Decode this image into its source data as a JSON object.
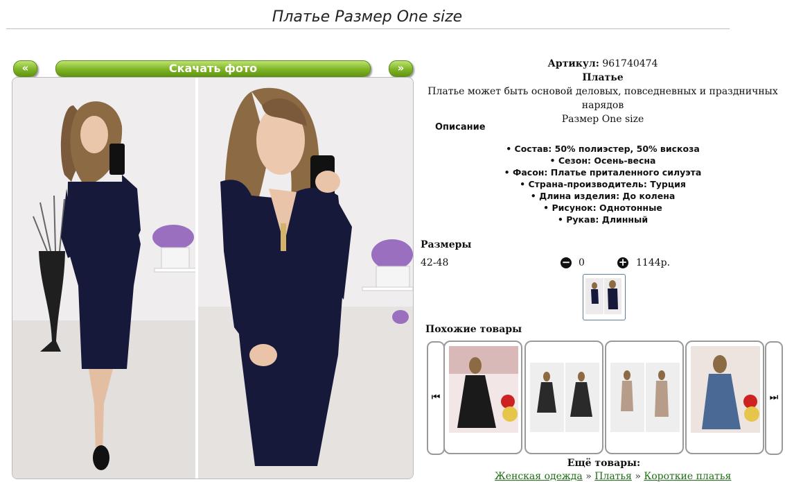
{
  "page": {
    "title": "Платье Размер One size"
  },
  "gallery": {
    "prev_label": "«",
    "download_label": "Скачать фото",
    "next_label": "»"
  },
  "product": {
    "article_label": "Артикул:",
    "article_value": "961740474",
    "name": "Платье",
    "tagline": "Платье может быть основой деловых, повседневных и праздничных нарядов",
    "size_line": "Размер One size"
  },
  "description": {
    "heading": "Описание",
    "features": [
      "Состав: 50% полиэстер, 50% вискоза",
      "Сезон: Осень-весна",
      "Фасон: Платье приталенного силуэта",
      "Страна-производитель: Турция",
      "Длина изделия: До колена",
      "Рисунок: Однотонные",
      "Рукав: Длинный"
    ]
  },
  "sizes": {
    "heading": "Размеры",
    "rows": [
      {
        "size": "42-48",
        "minus": "−",
        "quantity": "0",
        "plus": "+",
        "price": "1144р."
      }
    ]
  },
  "similar": {
    "heading": "Похожие товары",
    "left_arrow": "⏮",
    "right_arrow": "⏭",
    "colors": [
      "#1a1a1a",
      "#2a2a2a",
      "#b89c8a",
      "#4a6a95"
    ]
  },
  "more": {
    "heading": "Ещё товары:",
    "breadcrumbs": [
      "Женская одежда",
      "Платья",
      "Короткие платья"
    ],
    "separator": "»"
  },
  "colors": {
    "button_green": "#7fb424",
    "dress_navy": "#17193a",
    "link_green": "#1b6e12"
  }
}
